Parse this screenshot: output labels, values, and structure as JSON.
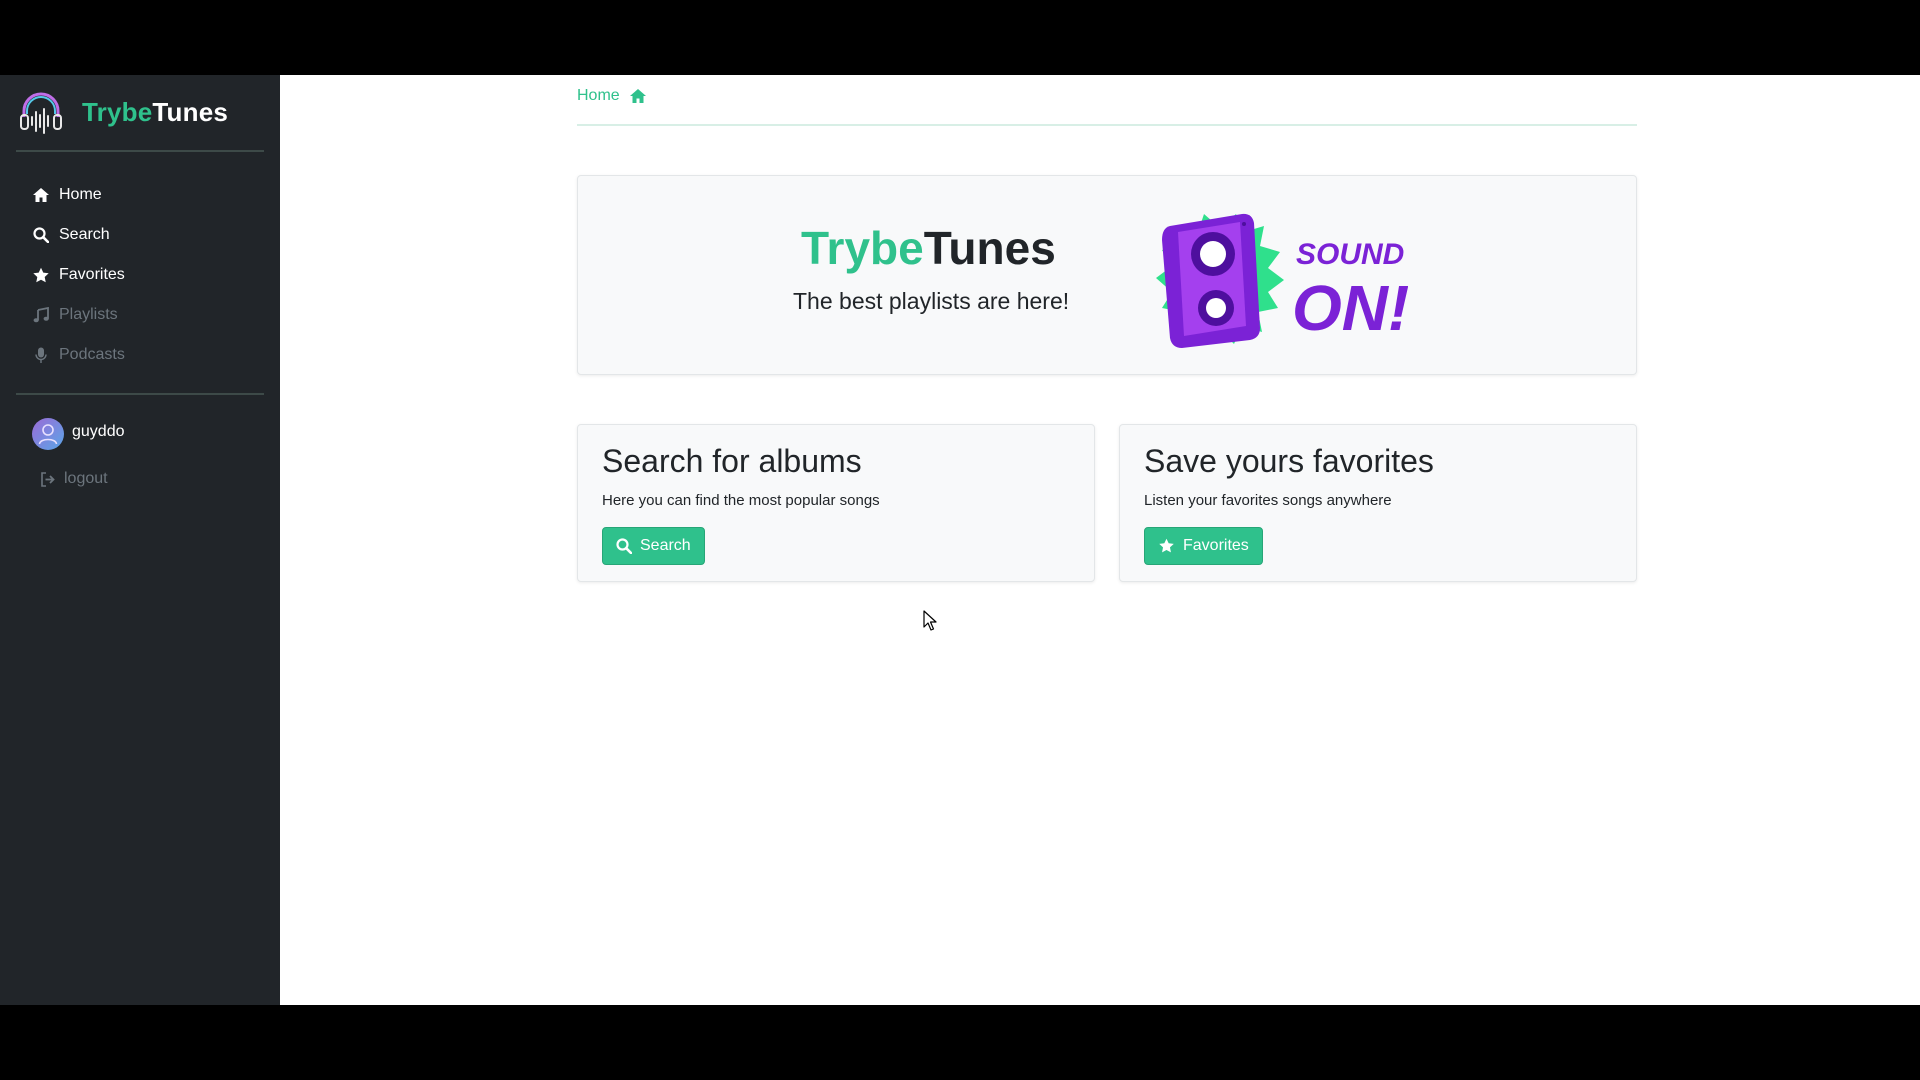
{
  "brand": {
    "name_accent": "Trybe",
    "name_rest": "Tunes"
  },
  "sidebar": {
    "items": [
      {
        "label": "Home",
        "icon": "home-icon",
        "enabled": true
      },
      {
        "label": "Search",
        "icon": "search-icon",
        "enabled": true
      },
      {
        "label": "Favorites",
        "icon": "star-icon",
        "enabled": true
      },
      {
        "label": "Playlists",
        "icon": "music-note-icon",
        "enabled": false
      },
      {
        "label": "Podcasts",
        "icon": "microphone-icon",
        "enabled": false
      }
    ],
    "user": {
      "name": "guyddo",
      "avatar": "user-avatar"
    },
    "logout_label": "logout"
  },
  "breadcrumb": {
    "label": "Home",
    "icon": "home-icon"
  },
  "hero": {
    "title_accent": "Trybe",
    "title_rest": "Tunes",
    "subtitle": "The best playlists are here!",
    "art_text_1": "SOUND",
    "art_text_2": "ON!"
  },
  "cards": [
    {
      "title": "Search for albums",
      "text": "Here you can find the most popular songs",
      "button_label": "Search",
      "button_icon": "search-icon"
    },
    {
      "title": "Save yours favorites",
      "text": "Listen your favorites songs anywhere",
      "button_label": "Favorites",
      "button_icon": "star-icon"
    }
  ],
  "colors": {
    "accent": "#2fc18c",
    "sidebar_bg": "#212529",
    "art_purple": "#7b22d6",
    "art_green": "#2fe08c"
  }
}
